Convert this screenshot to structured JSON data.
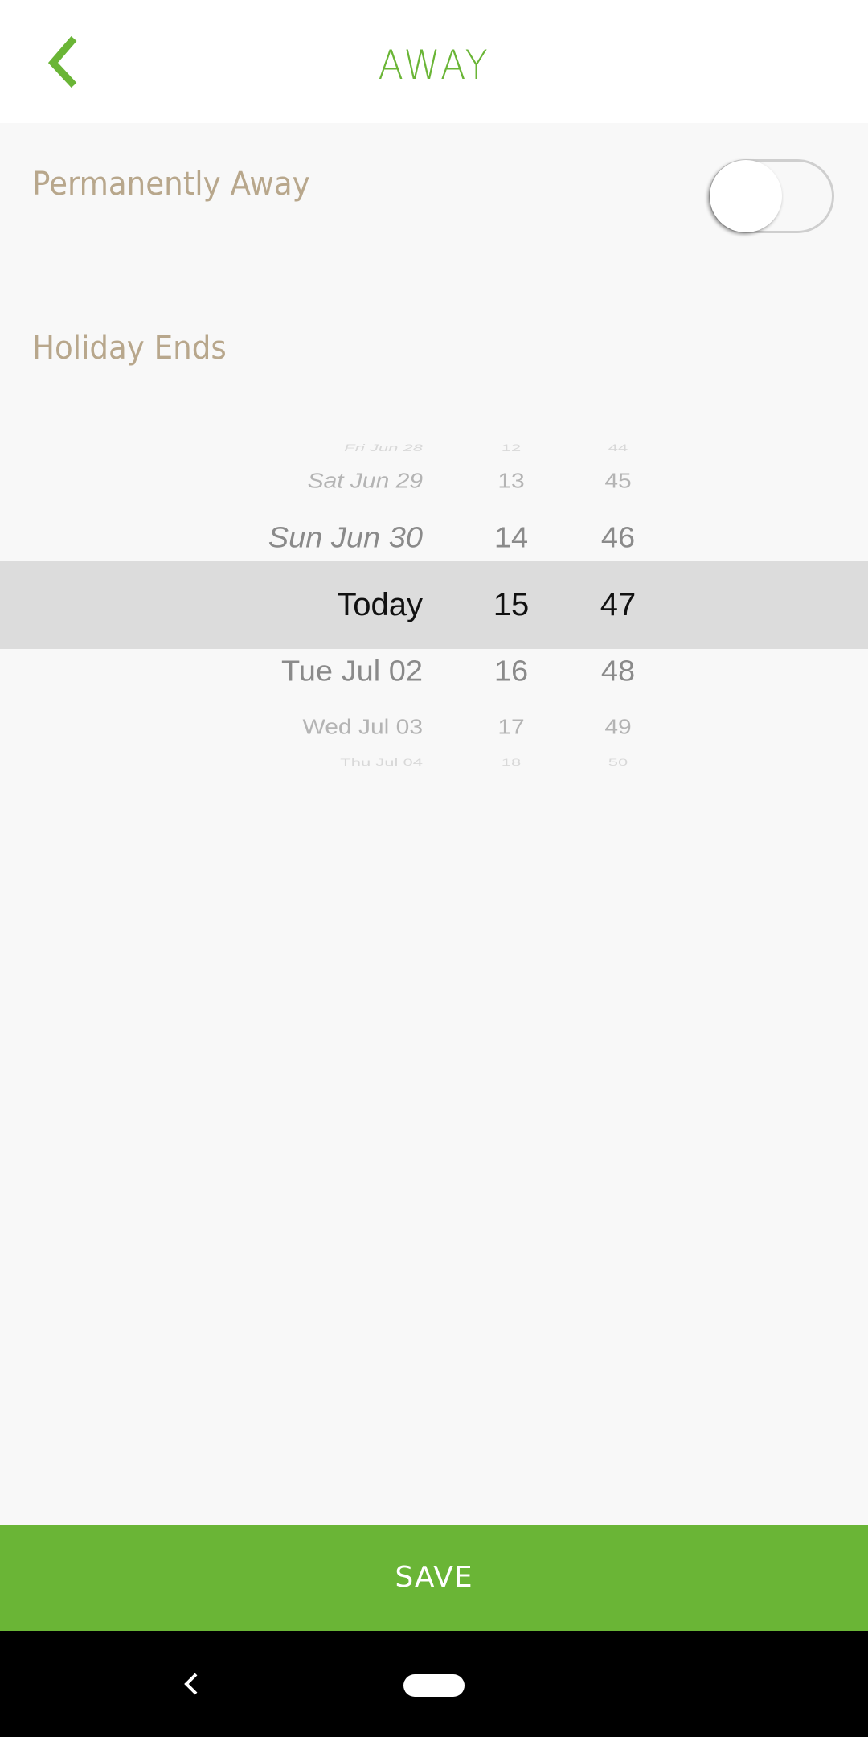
{
  "header": {
    "title": "AWAY",
    "back_icon": "chevron-left-icon",
    "accent_color": "#6ab536"
  },
  "settings": {
    "permanently_away": {
      "label": "Permanently Away",
      "enabled": false
    },
    "holiday_ends": {
      "label": "Holiday Ends"
    }
  },
  "picker": {
    "rows": [
      {
        "date": "Fri Jun 28",
        "hour": "12",
        "minute": "44"
      },
      {
        "date": "Sat Jun 29",
        "hour": "13",
        "minute": "45"
      },
      {
        "date": "Sun Jun 30",
        "hour": "14",
        "minute": "46"
      },
      {
        "date": "Today",
        "hour": "15",
        "minute": "47"
      },
      {
        "date": "Tue Jul 02",
        "hour": "16",
        "minute": "48"
      },
      {
        "date": "Wed Jul 03",
        "hour": "17",
        "minute": "49"
      },
      {
        "date": "Thu Jul 04",
        "hour": "18",
        "minute": "50"
      }
    ],
    "selected": {
      "date": "Today",
      "hour": "15",
      "minute": "47"
    }
  },
  "footer": {
    "save_label": "SAVE"
  },
  "system_nav": {
    "back_icon": "nav-back-icon",
    "home_icon": "home-pill-icon"
  }
}
